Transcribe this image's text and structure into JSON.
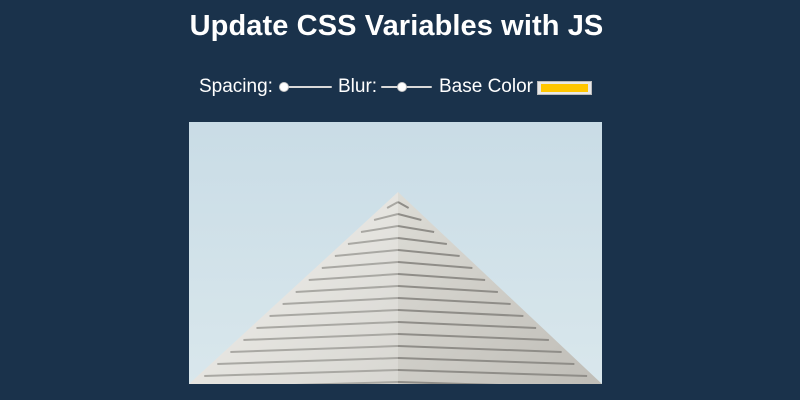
{
  "header": {
    "title": "Update CSS Variables with JS"
  },
  "controls": {
    "spacing": {
      "label": "Spacing:",
      "value": 10,
      "min": 10,
      "max": 200
    },
    "blur": {
      "label": "Blur:",
      "value": 10,
      "min": 0,
      "max": 25
    },
    "base_color": {
      "label": "Base Color",
      "value": "#ffc600"
    }
  },
  "image": {
    "icon": "building-photo",
    "sky_color": "#d3e3ea",
    "facade_color": "#ecebe6"
  }
}
